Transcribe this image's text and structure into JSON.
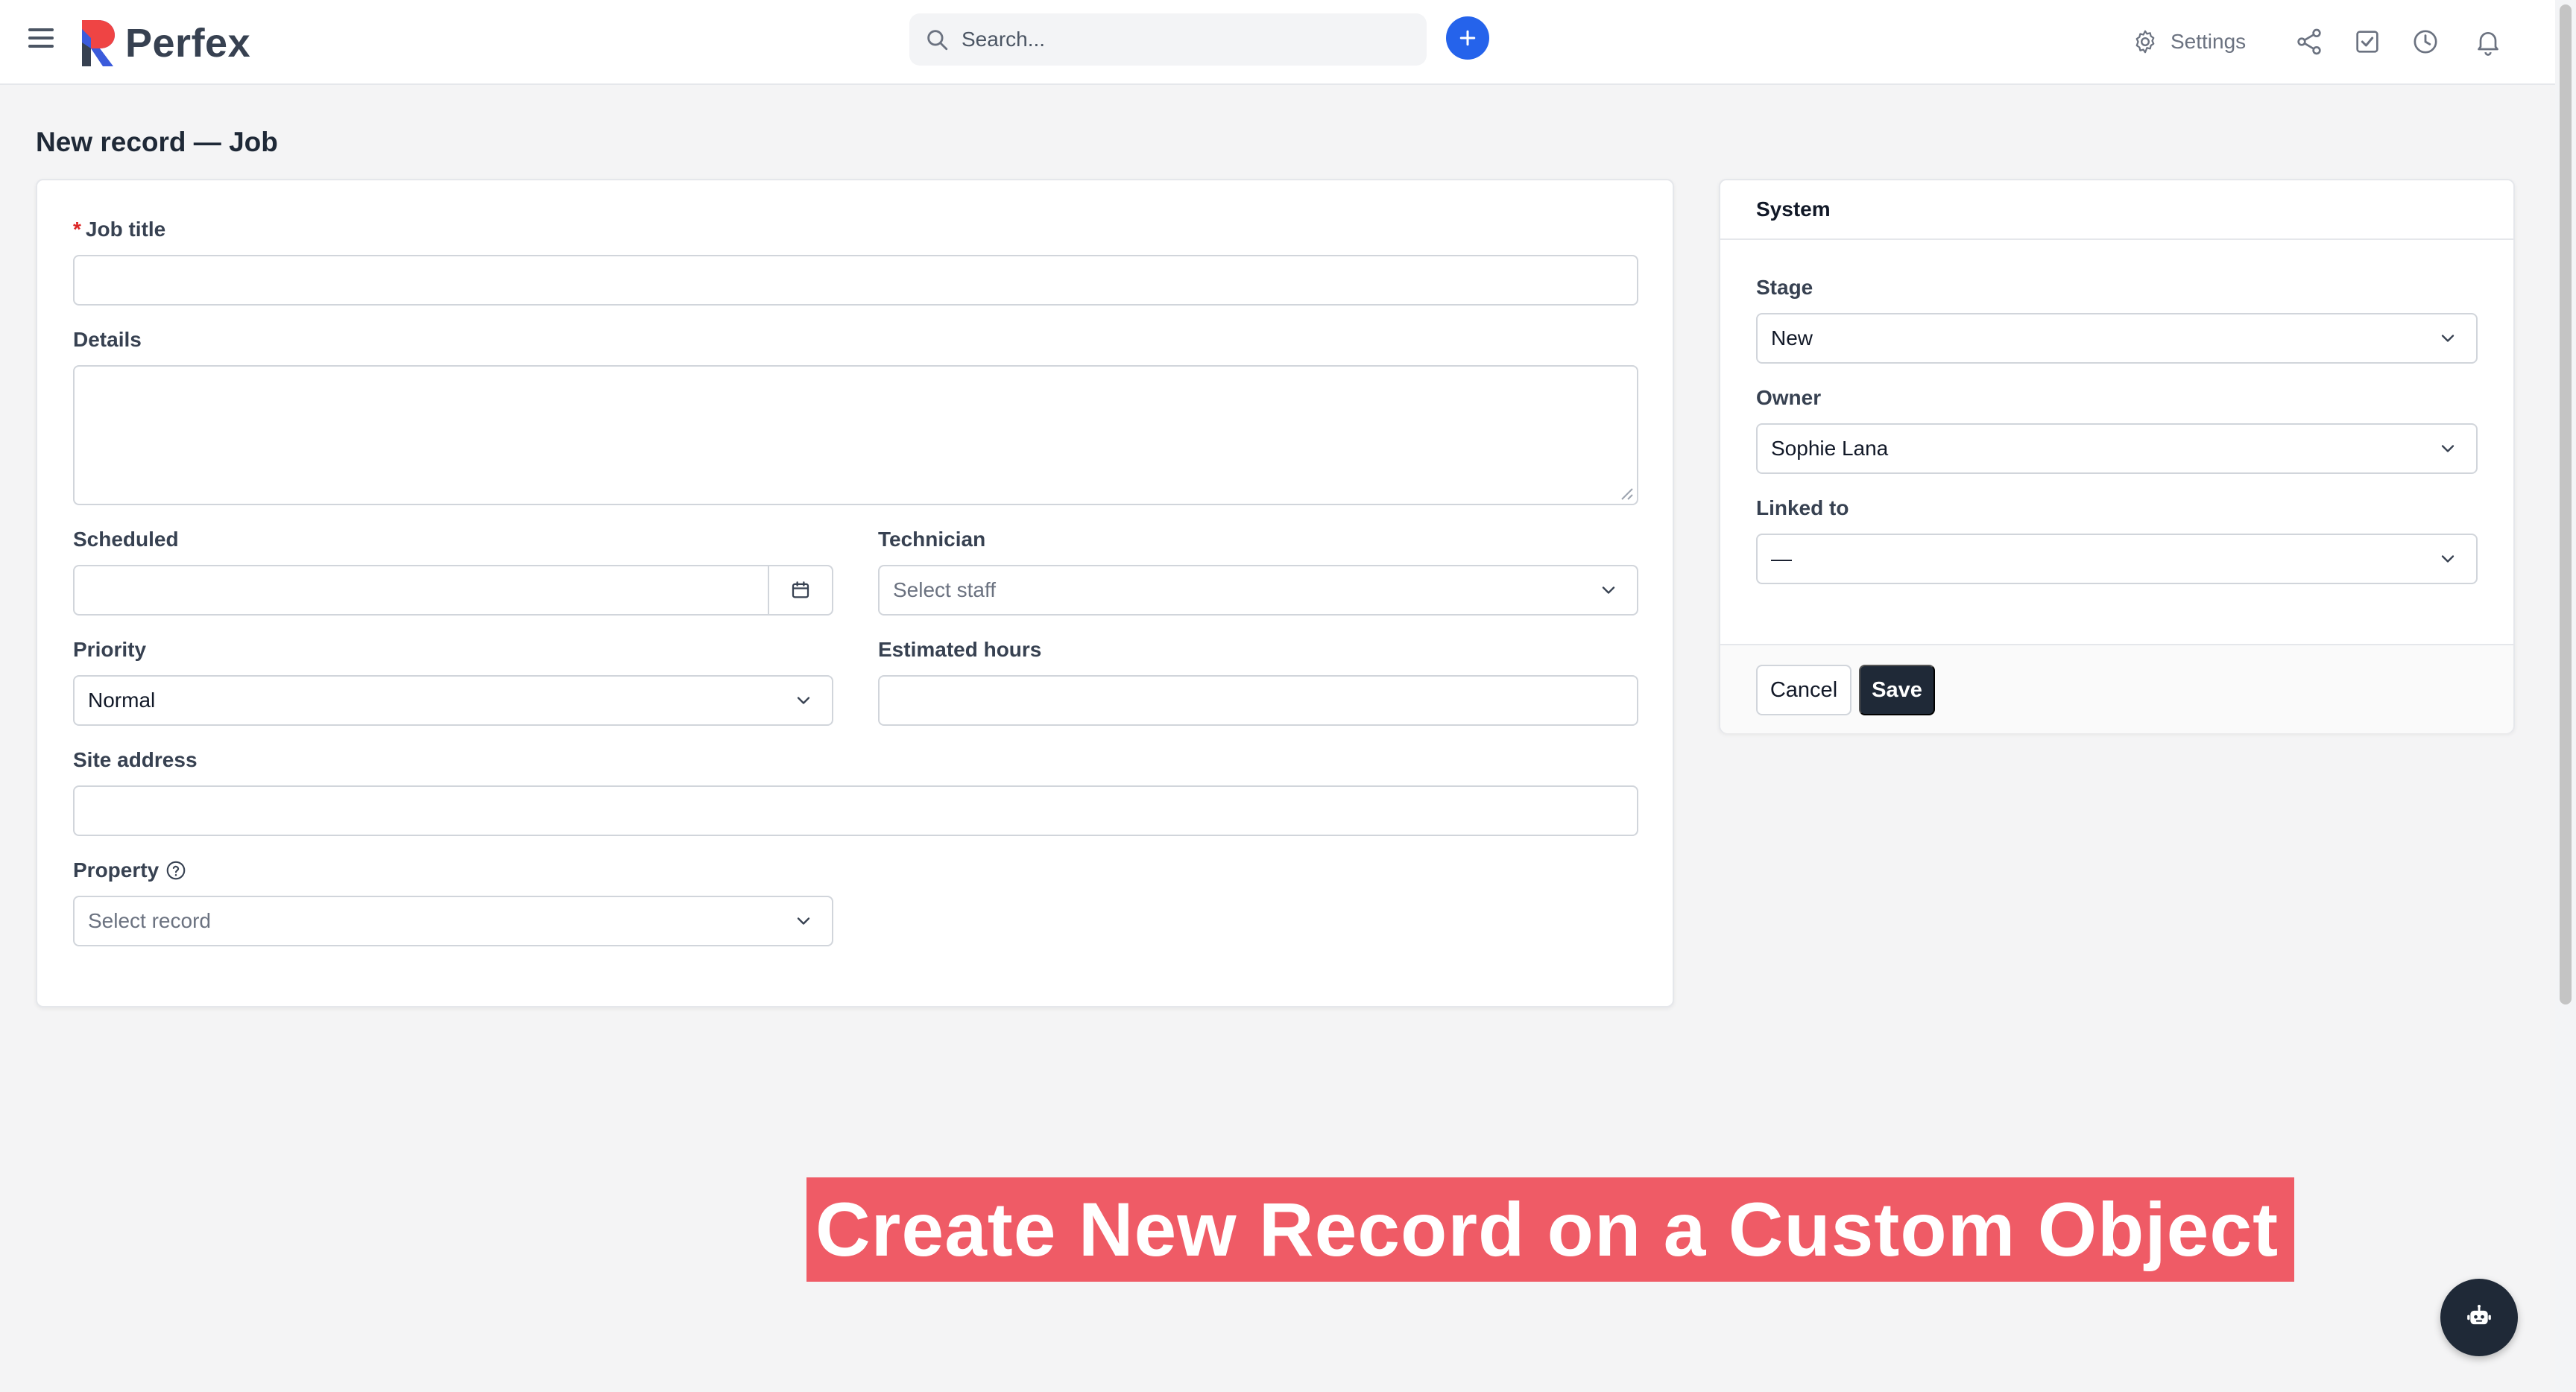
{
  "header": {
    "logo_text": "Perfex",
    "search_placeholder": "Search...",
    "settings_label": "Settings"
  },
  "page": {
    "title": "New record — Job"
  },
  "form": {
    "job_title": {
      "label": "Job title",
      "value": ""
    },
    "details": {
      "label": "Details",
      "value": ""
    },
    "scheduled": {
      "label": "Scheduled",
      "value": ""
    },
    "technician": {
      "label": "Technician",
      "placeholder": "Select staff"
    },
    "priority": {
      "label": "Priority",
      "value": "Normal"
    },
    "estimated_hours": {
      "label": "Estimated hours",
      "value": ""
    },
    "site_address": {
      "label": "Site address",
      "value": ""
    },
    "property": {
      "label": "Property",
      "placeholder": "Select record"
    }
  },
  "system": {
    "title": "System",
    "stage": {
      "label": "Stage",
      "value": "New"
    },
    "owner": {
      "label": "Owner",
      "value": "Sophie Lana"
    },
    "linked_to": {
      "label": "Linked to",
      "value": "—"
    },
    "cancel_label": "Cancel",
    "save_label": "Save"
  },
  "banner": {
    "text": "Create New Record on a Custom Object"
  },
  "colors": {
    "accent": "#2563eb",
    "dark": "#1f2937",
    "banner": "#ef5b66",
    "required": "#dc2626"
  }
}
